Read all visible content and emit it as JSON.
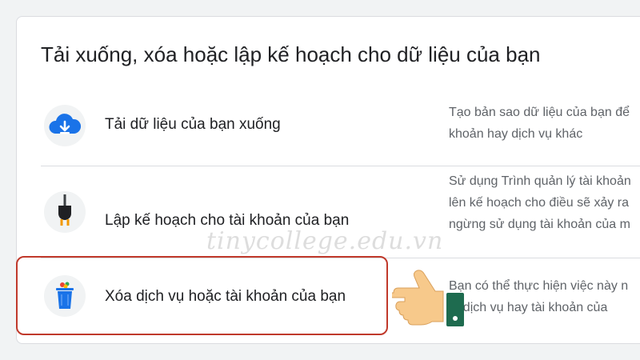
{
  "card": {
    "title": "Tải xuống, xóa hoặc lập kế hoạch cho dữ liệu của bạn"
  },
  "rows": [
    {
      "icon": "cloud-download-icon",
      "label": "Tải dữ liệu của bạn xuống",
      "description_lines": [
        "Tạo bản sao dữ liệu của bạn để",
        "khoản hay dịch vụ khác"
      ]
    },
    {
      "icon": "power-plug-icon",
      "label": "Lập kế hoạch cho tài khoản của bạn",
      "description_lines": [
        "Sử dụng Trình quản lý tài khoản",
        "lên kế hoạch cho điều sẽ xảy ra",
        "ngừng sử dụng tài khoản của m"
      ]
    },
    {
      "icon": "trash-can-icon",
      "label": "Xóa dịch vụ hoặc tài khoản của bạn",
      "description_lines": [
        "Bạn có thể thực hiện việc này n",
        "ột dịch vụ hay tài khoản của"
      ],
      "highlighted": true
    }
  ],
  "watermark": "tinycollege.edu.vn",
  "colors": {
    "highlight_border": "#c0392b",
    "icon_blue": "#1a73e8",
    "divider": "#dadce0"
  }
}
